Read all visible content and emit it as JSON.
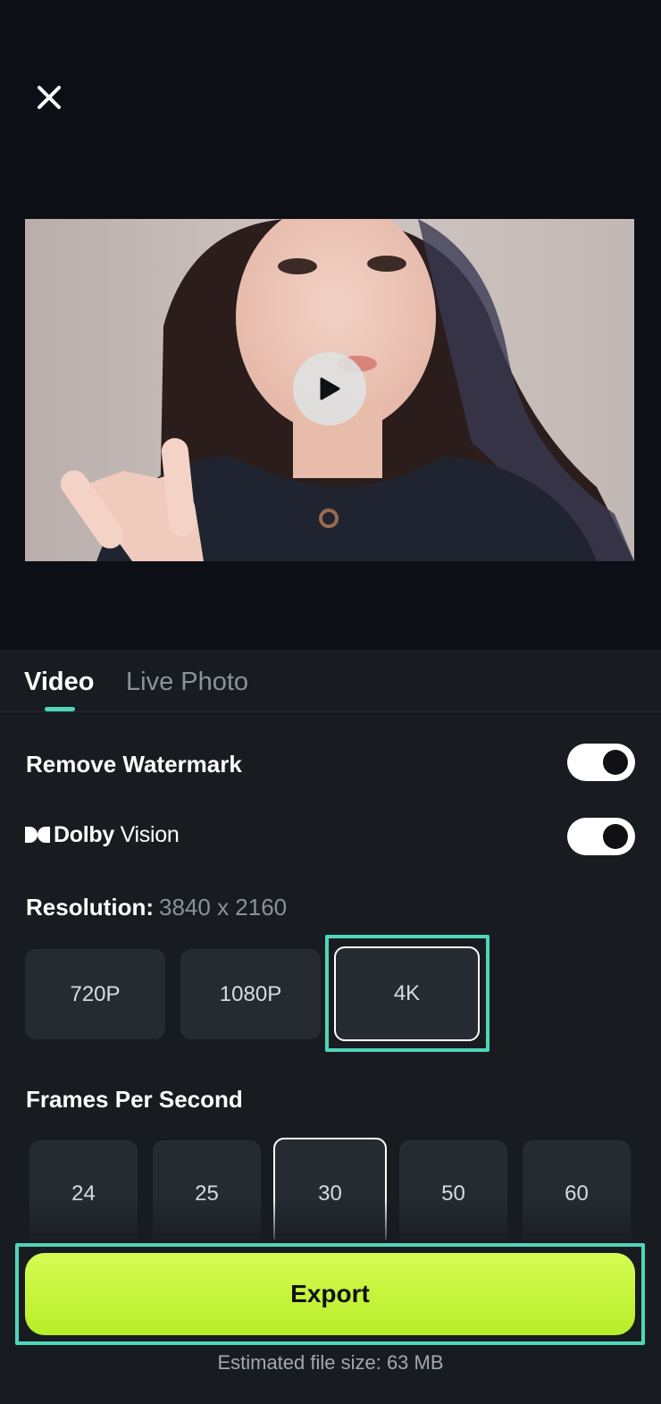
{
  "header": {
    "close_icon": "close-icon"
  },
  "preview": {
    "play_icon": "play-icon"
  },
  "tabs": [
    {
      "label": "Video",
      "active": true
    },
    {
      "label": "Live Photo",
      "active": false
    }
  ],
  "settings": {
    "remove_watermark": {
      "label": "Remove Watermark",
      "enabled": true
    },
    "dolby_vision": {
      "brand_bold": "Dolby",
      "brand_light": " Vision",
      "enabled": true
    }
  },
  "resolution": {
    "label": "Resolution:",
    "value": "3840 x 2160",
    "options": [
      "720P",
      "1080P",
      "4K"
    ],
    "selected": "4K"
  },
  "fps": {
    "label": "Frames Per Second",
    "options": [
      "24",
      "25",
      "30",
      "50",
      "60"
    ],
    "selected": "30"
  },
  "export": {
    "button_label": "Export",
    "file_size_text": "Estimated file size: 63 MB"
  },
  "colors": {
    "accent": "#4fd6b9",
    "export_button": "#c6f53a",
    "background": "#0c1016",
    "sheet": "#181c21"
  }
}
